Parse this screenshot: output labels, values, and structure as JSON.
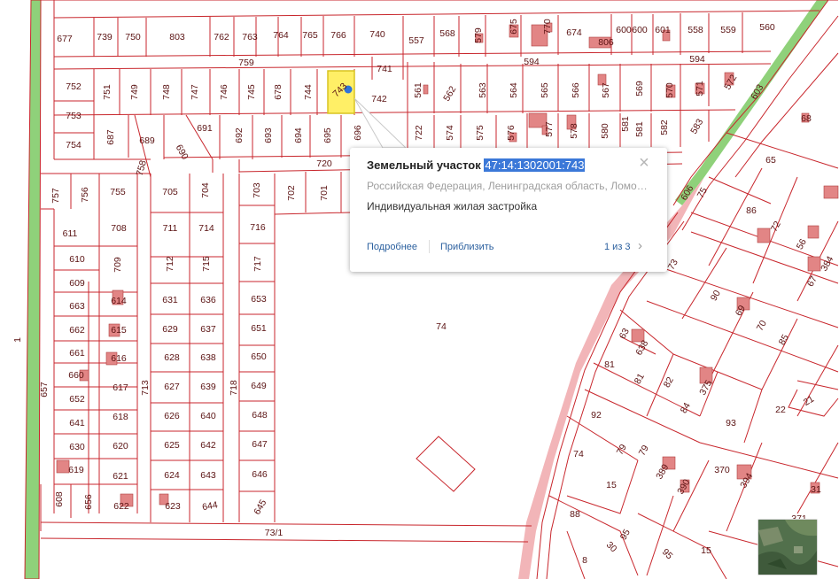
{
  "popup": {
    "title": "Земельный участок",
    "cadastral_number": "47:14:1302001:743",
    "address": "Российская Федерация, Ленинградская область, Ломоносовский район",
    "permitted_use": "Индивидуальная жилая застройка",
    "details_link": "Подробнее",
    "zoom_link": "Приблизить",
    "pagination": "1 из 3"
  },
  "colors": {
    "boundary": "#c8262c",
    "building_fill": "#e28585",
    "selected_fill": "#ffef66",
    "selected_stroke": "#d8c420",
    "road_green": "#8fd17a",
    "road_pink": "#f2b5b8",
    "marker": "#2f73d9",
    "label": "#5a1212"
  },
  "map_labels": {
    "l1": "677",
    "l2": "739",
    "l3": "750",
    "l4": "803",
    "l5": "762",
    "l6": "763",
    "l7": "764",
    "l8": "765",
    "l9": "766",
    "l10": "740",
    "l11": "557",
    "l12": "568",
    "l13": "579",
    "l14": "675",
    "l15": "770",
    "l16": "674",
    "l17": "806",
    "l18": "600",
    "l19": "600",
    "l20": "601",
    "l21": "558",
    "l22": "559",
    "l23": "560",
    "l24": "759",
    "l25": "741",
    "l26": "594",
    "l27": "594",
    "l28": "752",
    "l29": "751",
    "l30": "749",
    "l31": "748",
    "l32": "747",
    "l33": "746",
    "l34": "745",
    "l35": "678",
    "l36": "744",
    "l37": "743",
    "l38": "742",
    "l39": "561",
    "l40": "562",
    "l41": "563",
    "l42": "564",
    "l43": "565",
    "l44": "566",
    "l45": "567",
    "l46": "569",
    "l47": "570",
    "l48": "571",
    "l49": "572",
    "l50": "603",
    "l51": "753",
    "l52": "754",
    "l53": "687",
    "l54": "689",
    "l55": "691",
    "l56": "692",
    "l57": "693",
    "l58": "694",
    "l59": "695",
    "l60": "696",
    "l61": "722",
    "l62": "574",
    "l63": "575",
    "l64": "576",
    "l65": "577",
    "l66": "578",
    "l67": "580",
    "l68": "581",
    "l69": "581",
    "l70": "582",
    "l71": "583",
    "l72": "68",
    "l73": "690",
    "l74": "758",
    "l75": "720",
    "l76": "65",
    "l77": "606",
    "l78": "757",
    "l79": "756",
    "l80": "755",
    "l81": "705",
    "l82": "704",
    "l83": "703",
    "l84": "702",
    "l85": "701",
    "l86": "75",
    "l87": "86",
    "l88": "611",
    "l89": "708",
    "l90": "711",
    "l91": "714",
    "l92": "716",
    "l93": "72",
    "l94": "56",
    "l95": "610",
    "l96": "709",
    "l97": "712",
    "l98": "715",
    "l99": "717",
    "l100": "73",
    "l101": "384",
    "l102": "67",
    "l103": "609",
    "l104": "614",
    "l105": "631",
    "l106": "636",
    "l107": "653",
    "l108": "90",
    "l109": "663",
    "l110": "69",
    "l111": "662",
    "l112": "615",
    "l113": "629",
    "l114": "637",
    "l115": "651",
    "l116": "74",
    "l117": "63",
    "l118": "70",
    "l119": "85",
    "l120": "1",
    "l121": "661",
    "l122": "616",
    "l123": "628",
    "l124": "638",
    "l125": "650",
    "l126": "638",
    "l127": "81",
    "l128": "660",
    "l129": "617",
    "l130": "713",
    "l131": "627",
    "l132": "639",
    "l133": "718",
    "l134": "649",
    "l135": "81",
    "l136": "82",
    "l137": "375",
    "l138": "657",
    "l139": "652",
    "l140": "618",
    "l141": "626",
    "l142": "640",
    "l143": "648",
    "l144": "92",
    "l145": "84",
    "l146": "22",
    "l147": "21",
    "l148": "641",
    "l149": "93",
    "l150": "630",
    "l151": "620",
    "l152": "625",
    "l153": "642",
    "l154": "647",
    "l155": "74",
    "l156": "79",
    "l157": "79",
    "l158": "619",
    "l159": "621",
    "l160": "624",
    "l161": "643",
    "l162": "646",
    "l163": "15",
    "l164": "389",
    "l165": "390",
    "l166": "370",
    "l167": "394",
    "l168": "31",
    "l169": "608",
    "l170": "656",
    "l171": "622",
    "l172": "623",
    "l173": "644",
    "l174": "645",
    "l175": "88",
    "l176": "371",
    "l177": "73/1",
    "l178": "95",
    "l179": "30",
    "l180": "95",
    "l181": "15",
    "l182": "8"
  }
}
